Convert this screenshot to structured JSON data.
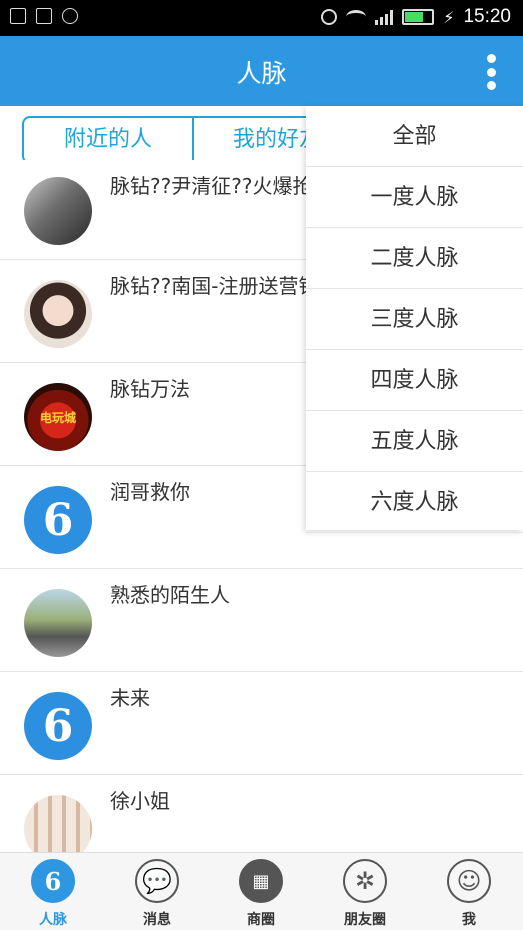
{
  "status_bar": {
    "time": "15:20",
    "battery_level": 0.7
  },
  "app_bar": {
    "title": "人脉"
  },
  "tabs": [
    {
      "label": "附近的人"
    },
    {
      "label": "我的好友"
    }
  ],
  "contacts": [
    {
      "name": "脉钻??尹清征??火爆抢"
    },
    {
      "name": "脉钻??南国-注册送营销"
    },
    {
      "name": "脉钻万法",
      "avatar_text": "电玩城"
    },
    {
      "name": "润哥救你",
      "avatar_text": "6"
    },
    {
      "name": "熟悉的陌生人"
    },
    {
      "name": "未来",
      "avatar_text": "6"
    },
    {
      "name": "徐小姐"
    }
  ],
  "dropdown": [
    {
      "label": "全部"
    },
    {
      "label": "一度人脉"
    },
    {
      "label": "二度人脉"
    },
    {
      "label": "三度人脉"
    },
    {
      "label": "四度人脉"
    },
    {
      "label": "五度人脉"
    },
    {
      "label": "六度人脉"
    }
  ],
  "bottom_nav": {
    "items": [
      {
        "label": "人脉",
        "icon": "6"
      },
      {
        "label": "消息",
        "icon": "chat-icon"
      },
      {
        "label": "商圈",
        "icon": "shop-icon"
      },
      {
        "label": "朋友圈",
        "icon": "camera-icon"
      },
      {
        "label": "我",
        "icon": "user-icon"
      }
    ]
  },
  "colors": {
    "primary": "#2d97e2",
    "tab_accent": "#1fa6d8"
  }
}
